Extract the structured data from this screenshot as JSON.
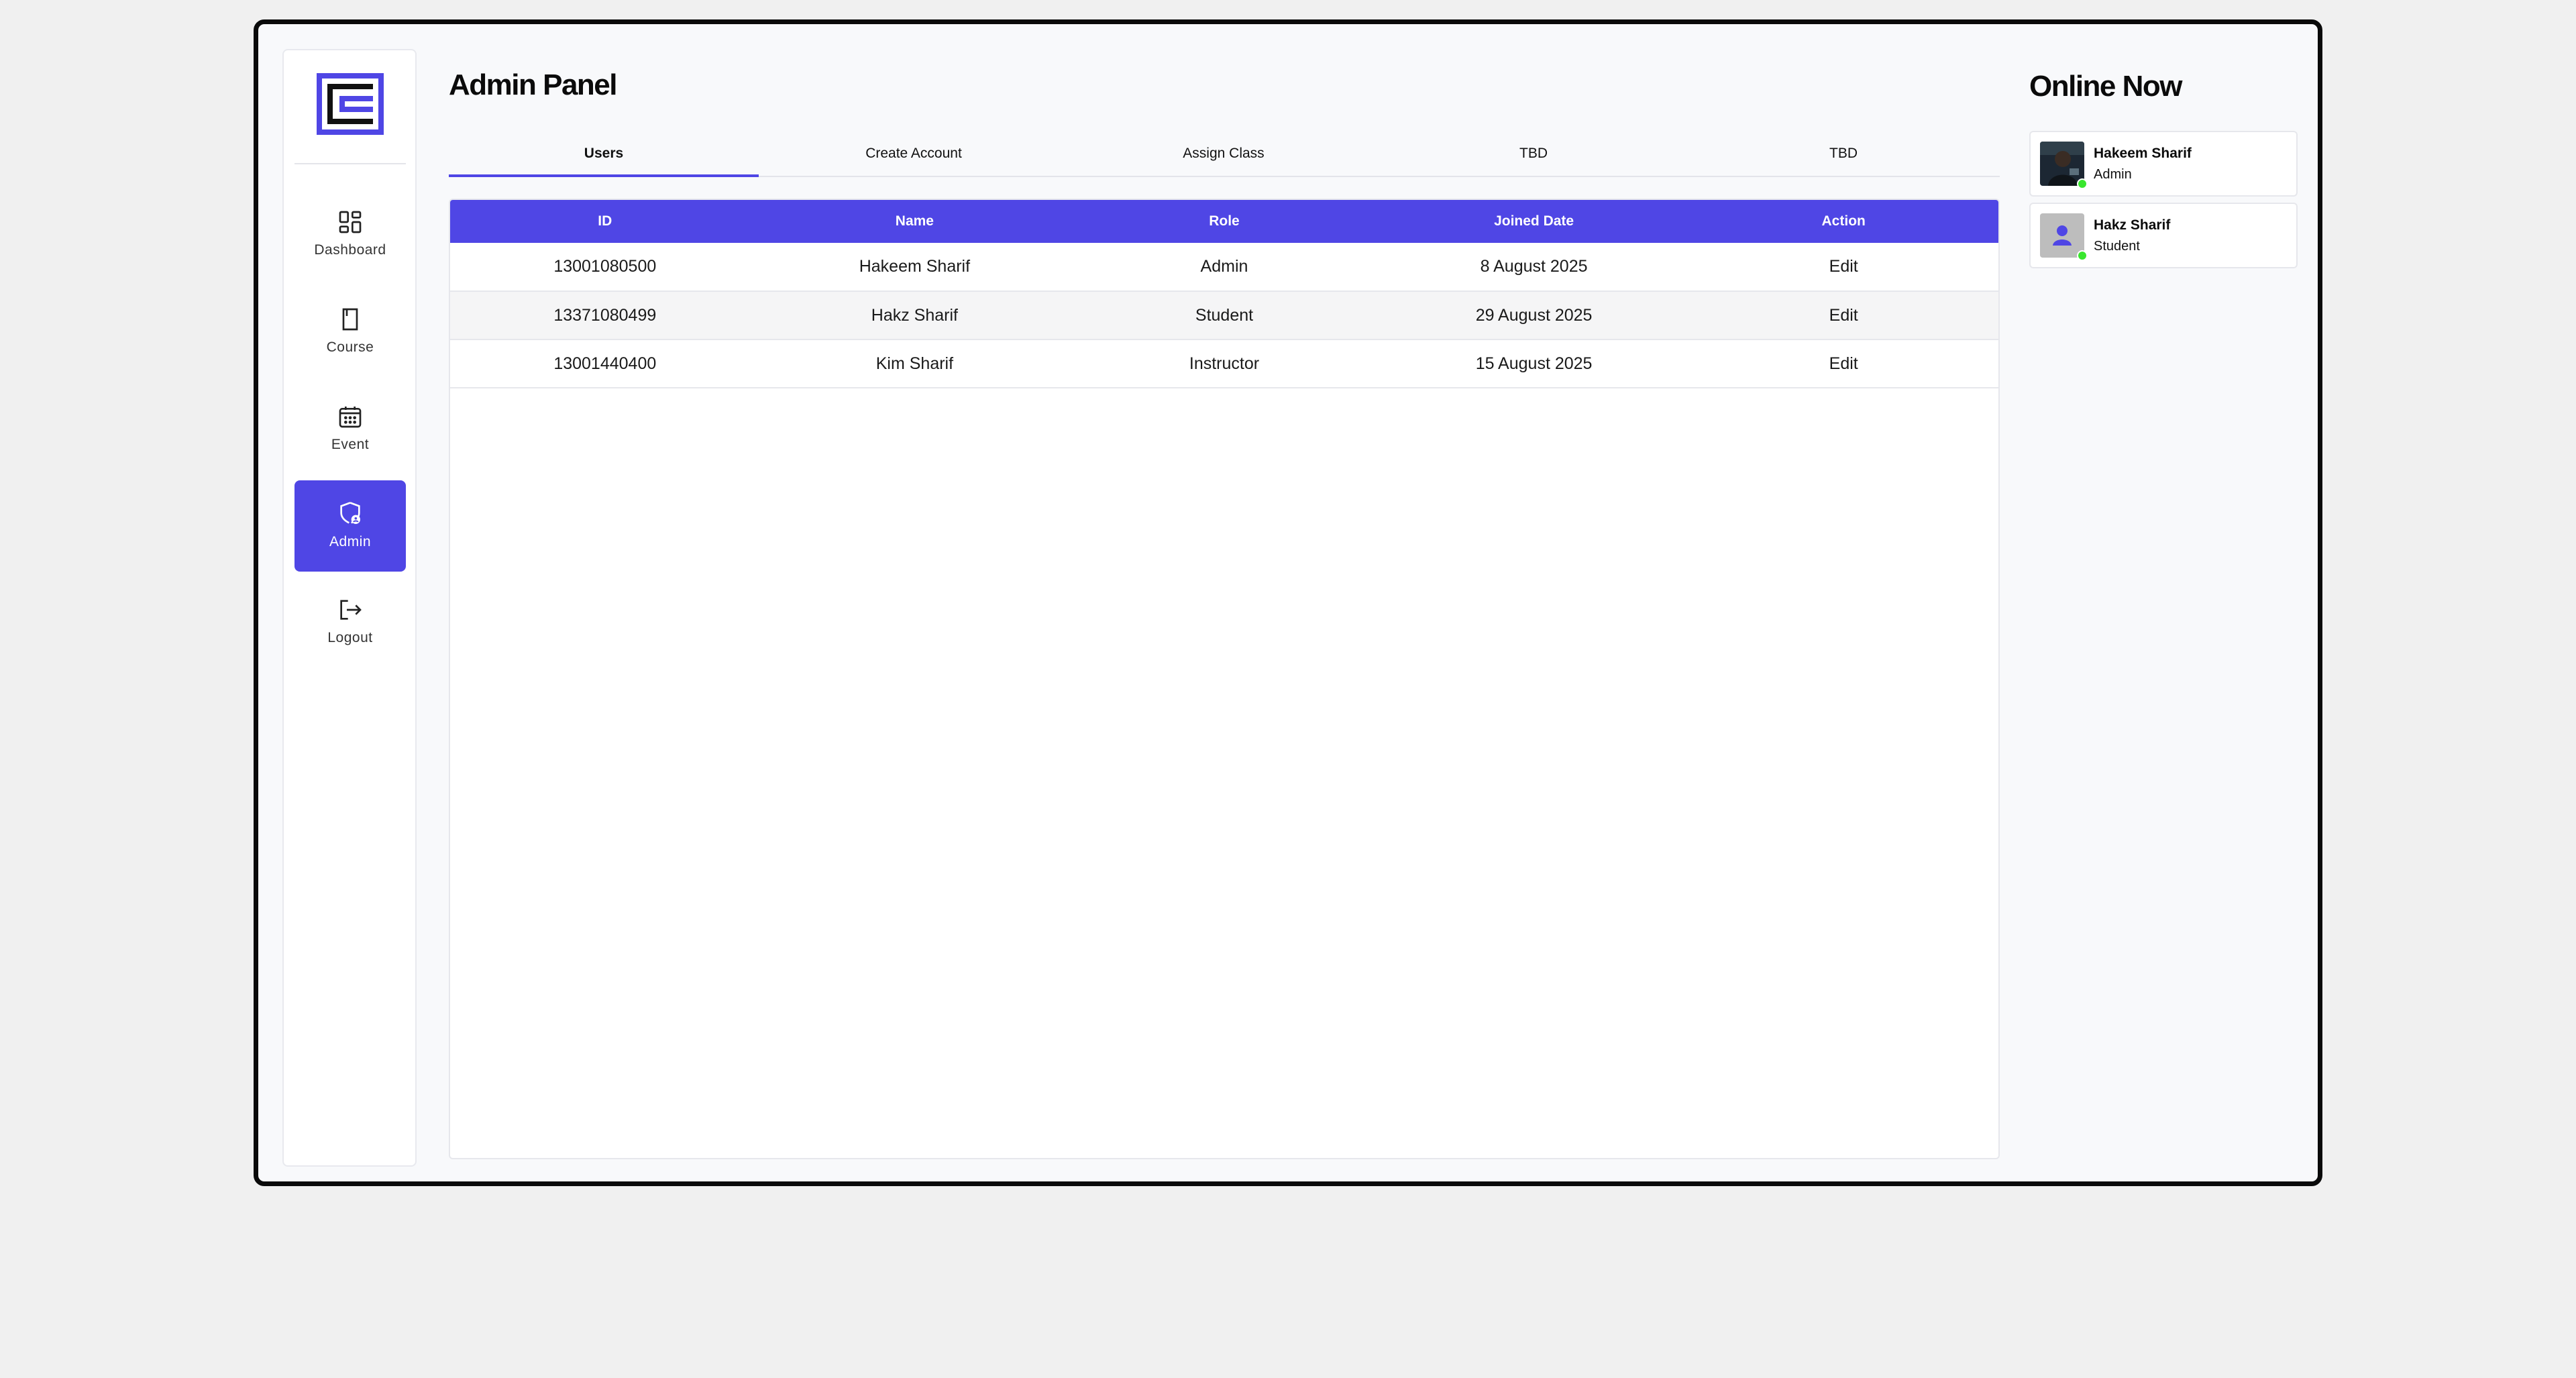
{
  "sidebar": {
    "items": [
      {
        "label": "Dashboard",
        "icon": "dashboard-icon"
      },
      {
        "label": "Course",
        "icon": "book-icon"
      },
      {
        "label": "Event",
        "icon": "calendar-icon"
      },
      {
        "label": "Admin",
        "icon": "shield-user-icon",
        "active": true
      },
      {
        "label": "Logout",
        "icon": "logout-icon"
      }
    ]
  },
  "main": {
    "title": "Admin Panel",
    "tabs": [
      {
        "label": "Users",
        "active": true
      },
      {
        "label": "Create Account"
      },
      {
        "label": "Assign Class"
      },
      {
        "label": "TBD"
      },
      {
        "label": "TBD"
      }
    ],
    "table": {
      "columns": [
        "ID",
        "Name",
        "Role",
        "Joined Date",
        "Action"
      ],
      "rows": [
        [
          "13001080500",
          "Hakeem Sharif",
          "Admin",
          "8 August 2025",
          "Edit"
        ],
        [
          "13371080499",
          "Hakz Sharif",
          "Student",
          "29 August 2025",
          "Edit"
        ],
        [
          "13001440400",
          "Kim Sharif",
          "Instructor",
          "15 August 2025",
          "Edit"
        ]
      ]
    }
  },
  "online": {
    "title": "Online Now",
    "users": [
      {
        "name": "Hakeem Sharif",
        "role": "Admin",
        "status": "online"
      },
      {
        "name": "Hakz Sharif",
        "role": "Student",
        "status": "online"
      }
    ]
  },
  "colors": {
    "accent": "#4f46e5",
    "online_dot": "#39e62e",
    "frame_border": "#0a0a0a",
    "page_bg": "#f0f0f0"
  }
}
